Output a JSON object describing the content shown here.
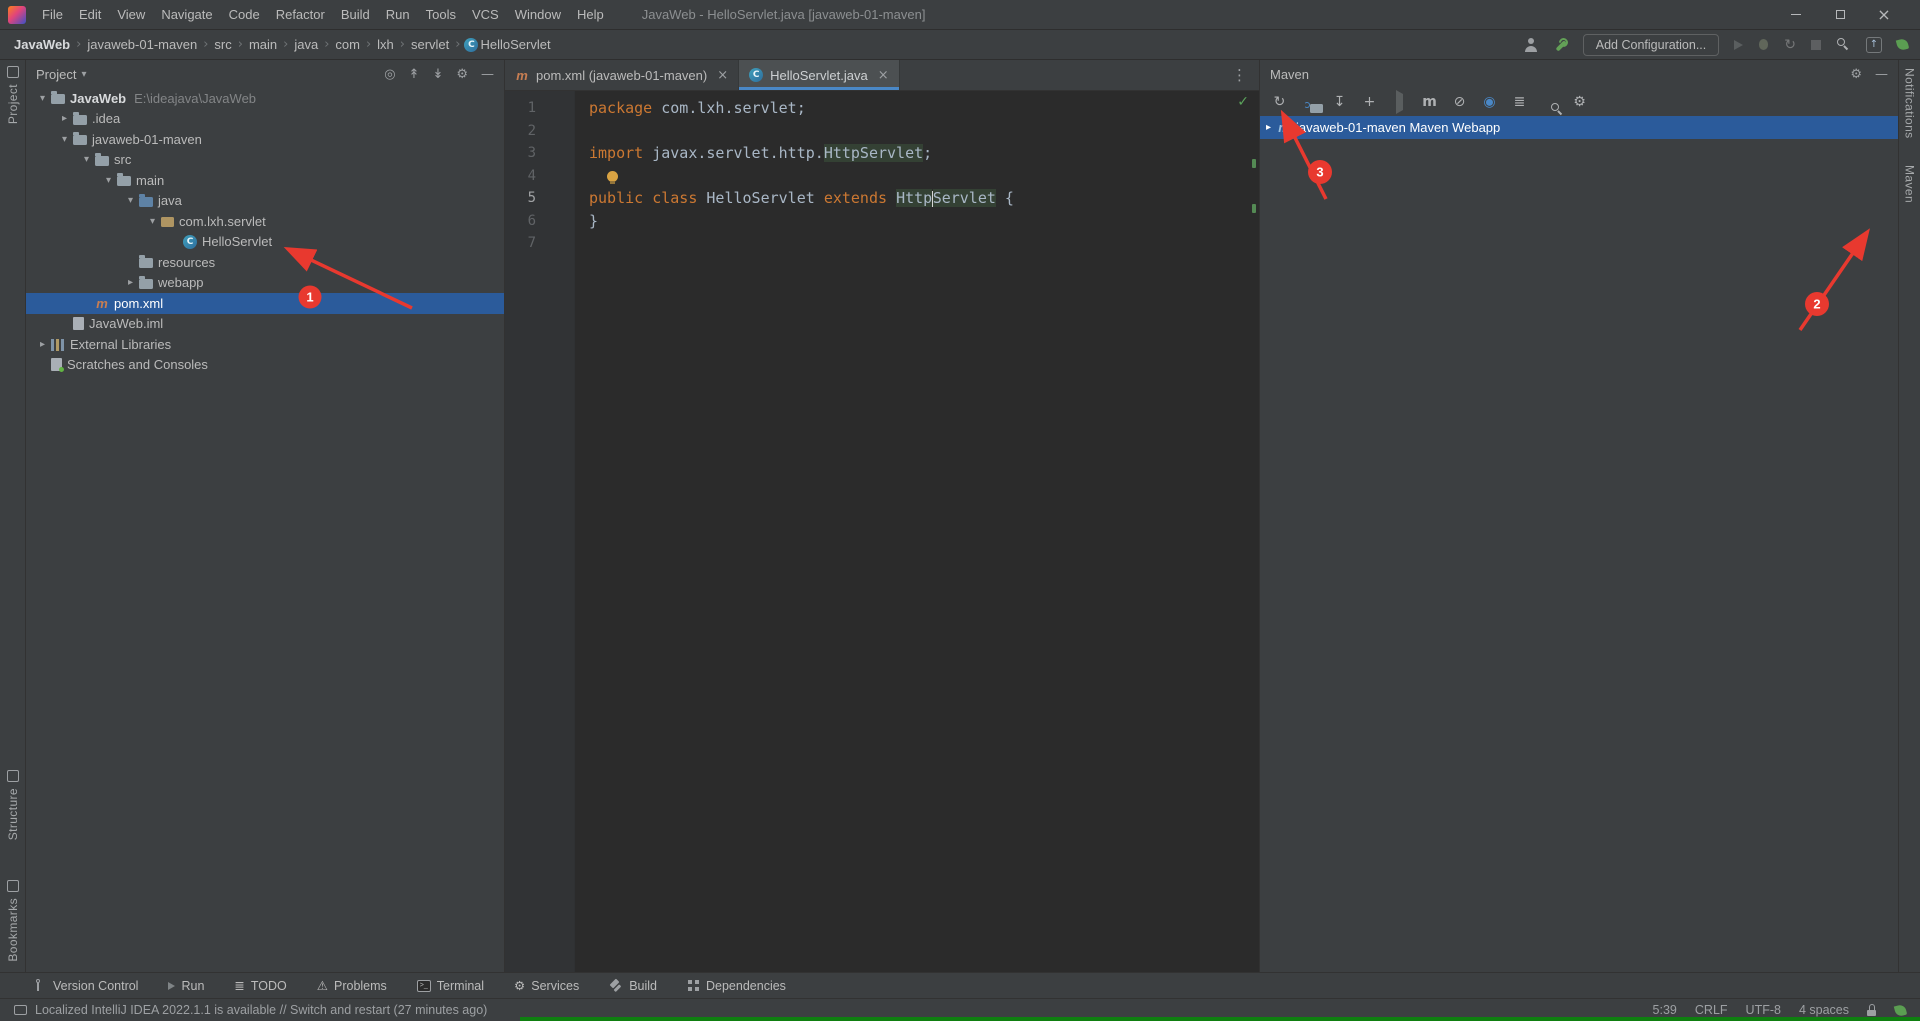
{
  "colors": {
    "red": "#e8392f",
    "selection": "#2b5b9b",
    "accent_blue": "#4a88c7",
    "ok_green": "#499c54"
  },
  "icons": {
    "caret_down": "▾",
    "caret_right": "▸",
    "chevron": "›",
    "close": "×",
    "more": "⋮",
    "gear": "⚙",
    "minimize": "—",
    "check": "✓",
    "refresh": "↻",
    "download": "↧",
    "plus": "+",
    "maven_m": "m",
    "skip": "⊘",
    "globe": "◉",
    "filter": "≣",
    "up_arrow": "↑",
    "class_c": "C",
    "target": "◎",
    "expand_all": "↟",
    "collapse_all": "↡",
    "warning": "⚠",
    "todo_list": "≣",
    "dropdown": "▾"
  },
  "title_bar": {
    "menus": [
      "File",
      "Edit",
      "View",
      "Navigate",
      "Code",
      "Refactor",
      "Build",
      "Run",
      "Tools",
      "VCS",
      "Window",
      "Help"
    ],
    "title": "JavaWeb - HelloServlet.java [javaweb-01-maven]"
  },
  "navbar": {
    "breadcrumbs": [
      "JavaWeb",
      "javaweb-01-maven",
      "src",
      "main",
      "java",
      "com",
      "lxh",
      "servlet",
      "HelloServlet"
    ],
    "add_configuration": "Add Configuration..."
  },
  "left_stripe": {
    "project": "Project",
    "structure": "Structure",
    "bookmarks": "Bookmarks"
  },
  "right_stripe": {
    "notifications": "Notifications",
    "maven": "Maven"
  },
  "project_panel": {
    "title": "Project",
    "tree": [
      {
        "label": "JavaWeb",
        "hint": "E:\\ideajava\\JavaWeb"
      },
      {
        "label": ".idea"
      },
      {
        "label": "javaweb-01-maven"
      },
      {
        "label": "src"
      },
      {
        "label": "main"
      },
      {
        "label": "java"
      },
      {
        "label": "com.lxh.servlet"
      },
      {
        "label": "HelloServlet"
      },
      {
        "label": "resources"
      },
      {
        "label": "webapp"
      },
      {
        "label": "pom.xml"
      },
      {
        "label": "JavaWeb.iml"
      },
      {
        "label": "External Libraries"
      },
      {
        "label": "Scratches and Consoles"
      }
    ]
  },
  "editor": {
    "tabs": {
      "tab1": "pom.xml (javaweb-01-maven)",
      "tab2": "HelloServlet.java"
    },
    "line_numbers": [
      "1",
      "2",
      "3",
      "4",
      "5",
      "6",
      "7"
    ],
    "code": {
      "l1_kw": "package",
      "l1_rest": " com.lxh.servlet;",
      "l3_kw": "import",
      "l3_mid": " javax.servlet.http.",
      "l3_hl": "HttpServlet",
      "l3_semi": ";",
      "l5_kw1": "public class",
      "l5_name": " HelloServlet ",
      "l5_kw2": "extends",
      "l5_sp": " ",
      "l5_hl1": "Http",
      "l5_hl2": "Servlet",
      "l5_brace": " {",
      "l6": "}"
    }
  },
  "maven_panel": {
    "title": "Maven",
    "root": "javaweb-01-maven Maven Webapp"
  },
  "bottom_bar": {
    "items": [
      "Version Control",
      "Run",
      "TODO",
      "Problems",
      "Terminal",
      "Services",
      "Build",
      "Dependencies"
    ]
  },
  "status_bar": {
    "message": "Localized IntelliJ IDEA 2022.1.1 is available // Switch and restart (27 minutes ago)",
    "position": "5:39",
    "line_separator": "CRLF",
    "encoding": "UTF-8",
    "indent": "4 spaces"
  },
  "annotations": {
    "badge1": "1",
    "badge2": "2",
    "badge3": "3"
  }
}
